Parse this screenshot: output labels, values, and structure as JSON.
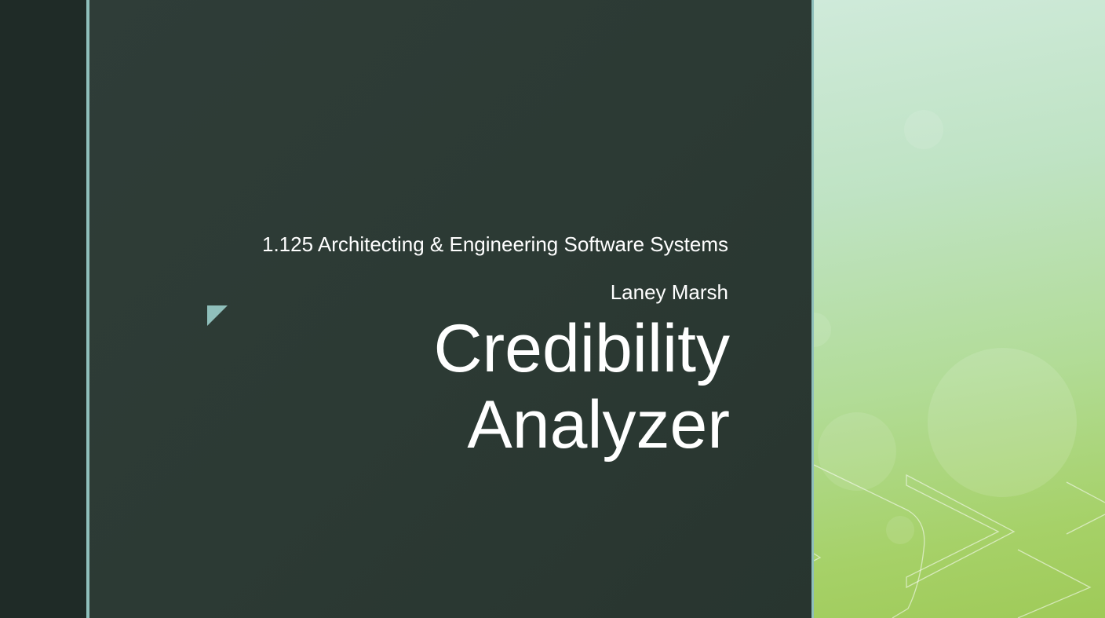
{
  "slide": {
    "subtitle": "1.125 Architecting & Engineering Software Systems",
    "author": "Laney Marsh",
    "title_lines": [
      "Credibility",
      "Analyzer"
    ]
  },
  "colors": {
    "accent": "#8fbfbb",
    "panel_dark": "#2c3a34",
    "strip_dark": "#1f2b27",
    "green_light": "#cfeada",
    "green_mid": "#a6d168",
    "text": "#ffffff"
  },
  "icons": {
    "corner_mark": "triangle-corner-icon",
    "background_art": "chevron-pattern-icon"
  }
}
